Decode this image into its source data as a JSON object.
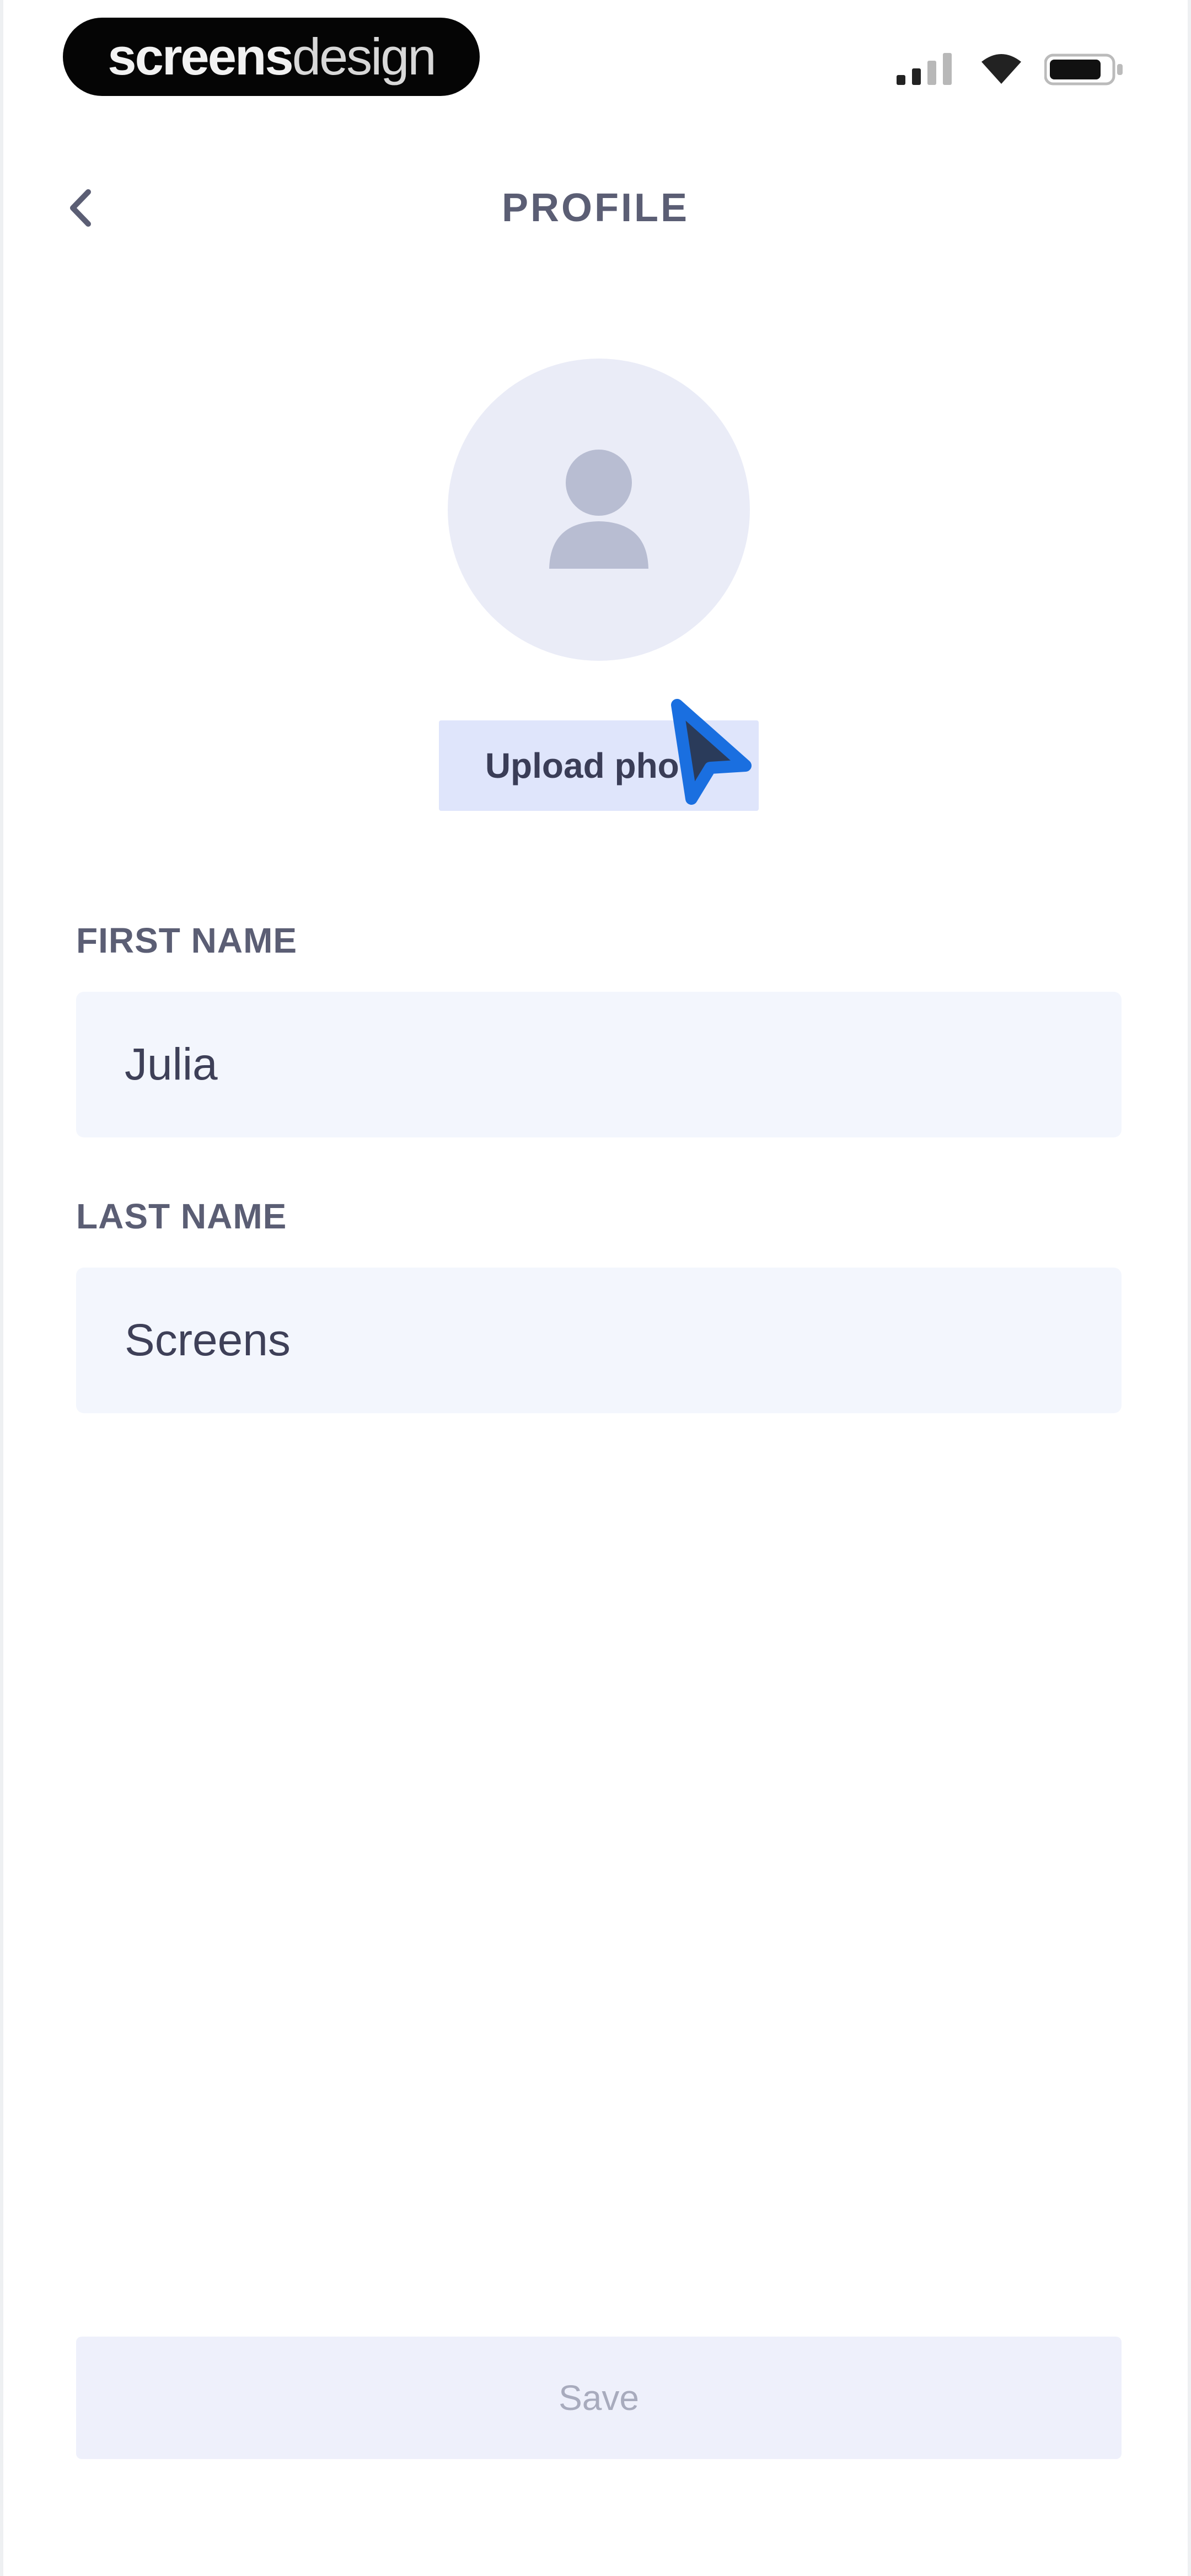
{
  "status_bar": {
    "brand_part1": "screens",
    "brand_part2": "design",
    "icons": [
      "signal-icon",
      "wifi-icon",
      "battery-icon"
    ]
  },
  "header": {
    "back_icon": "chevron-left-icon",
    "title": "PROFILE"
  },
  "avatar": {
    "icon": "person-icon",
    "upload_label": "Upload photo"
  },
  "form": {
    "first_name": {
      "label": "FIRST NAME",
      "value": "Julia"
    },
    "last_name": {
      "label": "LAST NAME",
      "value": "Screens"
    }
  },
  "footer": {
    "save_label": "Save"
  },
  "colors": {
    "accent_cursor": "#1a6fe0",
    "input_bg": "#f3f6fd",
    "avatar_bg": "#eaecf7",
    "upload_bg": "#dfe5fb"
  }
}
